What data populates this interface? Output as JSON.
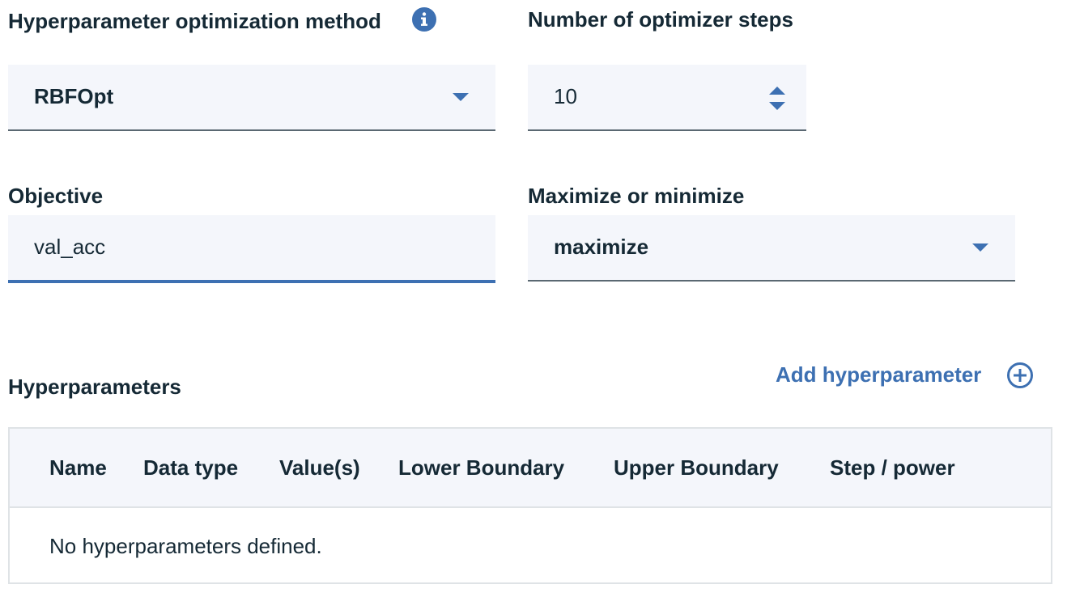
{
  "method": {
    "label": "Hyperparameter optimization method",
    "value": "RBFOpt",
    "info_icon": "info-icon"
  },
  "steps": {
    "label": "Number of optimizer steps",
    "value": "10"
  },
  "objective": {
    "label": "Objective",
    "value": "val_acc"
  },
  "direction": {
    "label": "Maximize or minimize",
    "value": "maximize"
  },
  "hyperparameters": {
    "title": "Hyperparameters",
    "add_label": "Add hyperparameter",
    "add_icon": "add-circle-icon",
    "columns": [
      "Name",
      "Data type",
      "Value(s)",
      "Lower Boundary",
      "Upper Boundary",
      "Step / power"
    ],
    "empty_text": "No hyperparameters defined."
  },
  "colors": {
    "accent": "#3d70b2",
    "field_bg": "#f4f6fb",
    "text": "#152935",
    "border": "#dfe3e6"
  }
}
